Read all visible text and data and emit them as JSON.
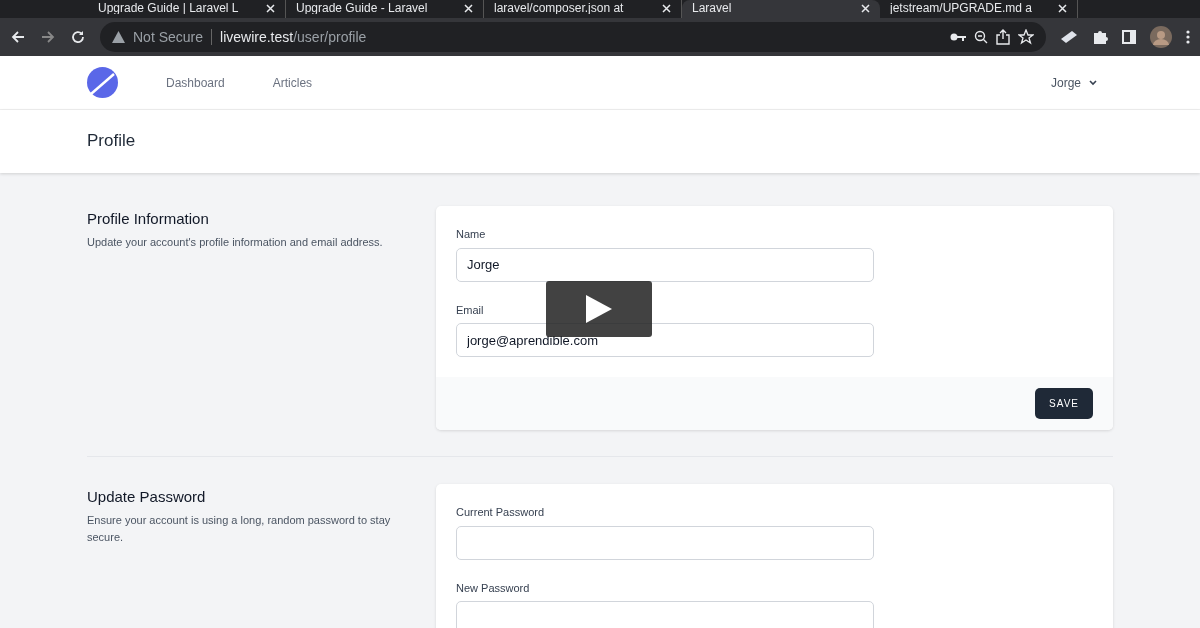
{
  "browser": {
    "tabs": [
      {
        "title": "Upgrade Guide | Laravel L",
        "selected": false
      },
      {
        "title": "Upgrade Guide - Laravel",
        "selected": false
      },
      {
        "title": "laravel/composer.json at",
        "selected": false
      },
      {
        "title": "Laravel",
        "selected": true
      },
      {
        "title": "jetstream/UPGRADE.md a",
        "selected": false
      }
    ],
    "security": "Not Secure",
    "url_host": "livewire.test",
    "url_path": "/user/profile"
  },
  "nav": {
    "links": [
      {
        "label": "Dashboard"
      },
      {
        "label": "Articles"
      }
    ],
    "user": "Jorge"
  },
  "header": {
    "title": "Profile"
  },
  "sections": [
    {
      "title": "Profile Information",
      "description": "Update your account's profile information and email address.",
      "fields": [
        {
          "label": "Name",
          "value": "Jorge"
        },
        {
          "label": "Email",
          "value": "jorge@aprendible.com"
        }
      ],
      "button": "SAVE"
    },
    {
      "title": "Update Password",
      "description": "Ensure your account is using a long, random password to stay secure.",
      "fields": [
        {
          "label": "Current Password"
        },
        {
          "label": "New Password"
        }
      ]
    }
  ]
}
